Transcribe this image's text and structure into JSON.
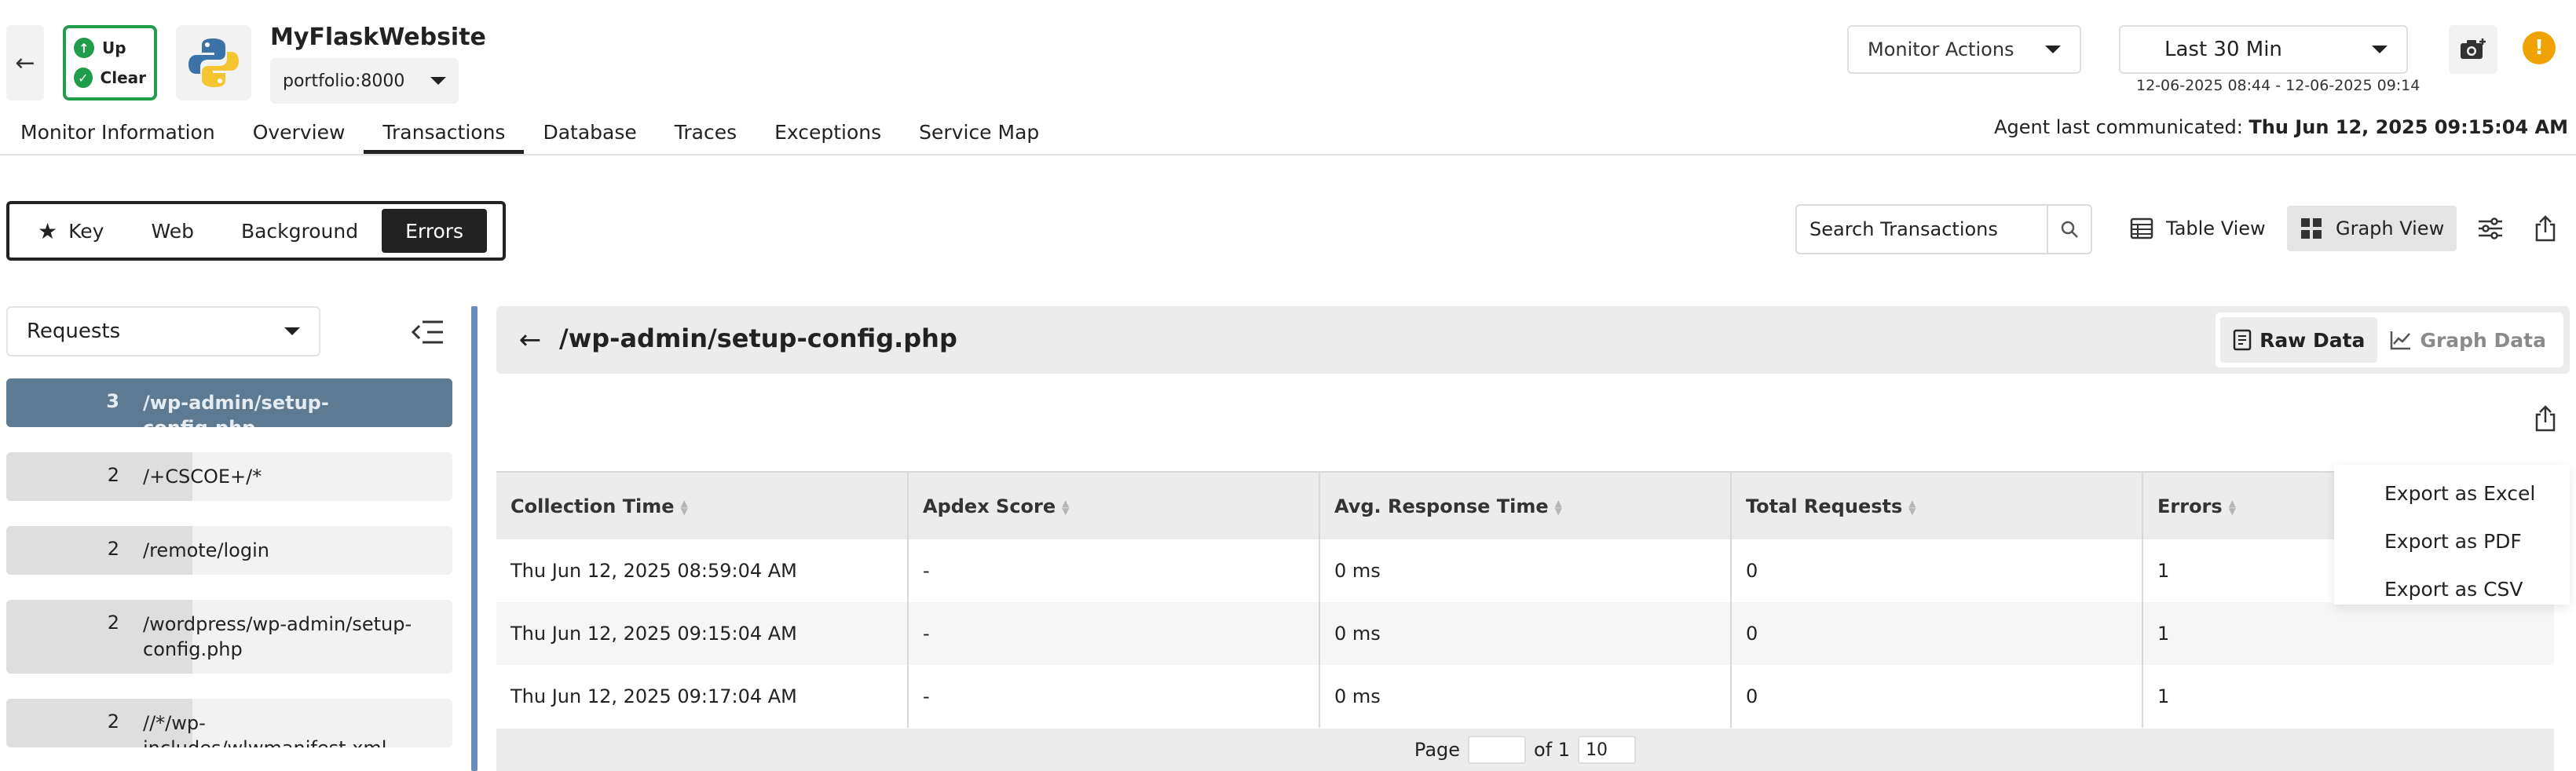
{
  "header": {
    "status_up": "Up",
    "status_clear": "Clear",
    "app_name": "MyFlaskWebsite",
    "instance": "portfolio:8000",
    "monitor_actions": "Monitor Actions",
    "time_range": "Last 30 Min",
    "time_detail": "12-06-2025 08:44 - 12-06-2025 09:14",
    "alert_glyph": "!",
    "status_color": "#1f9d4a",
    "alert_color": "#f0a202"
  },
  "nav": {
    "tabs": [
      "Monitor Information",
      "Overview",
      "Transactions",
      "Database",
      "Traces",
      "Exceptions",
      "Service Map"
    ],
    "active_tab": "Transactions",
    "agent_label": "Agent last communicated: ",
    "agent_time": "Thu Jun 12, 2025 09:15:04 AM"
  },
  "filters": {
    "types": [
      "Key",
      "Web",
      "Background",
      "Errors"
    ],
    "active_type": "Errors",
    "search_placeholder": "Search Transactions",
    "table_view_label": "Table View",
    "graph_view_label": "Graph View"
  },
  "left_panel": {
    "metric": "Requests",
    "items": [
      {
        "count": "3",
        "path": "/wp-admin/setup-config.php",
        "fraction": 1.0,
        "active": true
      },
      {
        "count": "2",
        "path": "/+CSCOE+/*",
        "fraction": 0.6667,
        "active": false
      },
      {
        "count": "2",
        "path": "/remote/login",
        "fraction": 0.6667,
        "active": false
      },
      {
        "count": "2",
        "path": "/wordpress/wp-admin/setup-config.php",
        "fraction": 0.6667,
        "active": false
      },
      {
        "count": "2",
        "path": "//*/wp-includes/wlwmanifest.xml",
        "fraction": 0.6667,
        "active": false
      }
    ]
  },
  "detail": {
    "title": "/wp-admin/setup-config.php",
    "raw_data_label": "Raw Data",
    "graph_data_label": "Graph Data",
    "columns": [
      "Collection Time",
      "Apdex Score",
      "Avg. Response Time",
      "Total Requests",
      "Errors"
    ],
    "rows": [
      [
        "Thu Jun 12, 2025 08:59:04 AM",
        "-",
        "0 ms",
        "0",
        "1"
      ],
      [
        "Thu Jun 12, 2025 09:15:04 AM",
        "-",
        "0 ms",
        "0",
        "1"
      ],
      [
        "Thu Jun 12, 2025 09:17:04 AM",
        "-",
        "0 ms",
        "0",
        "1"
      ]
    ],
    "pagination": {
      "page_label": "Page",
      "of_label": "of 1",
      "page_size": "10"
    }
  },
  "export_menu": {
    "items": [
      "Export as Excel",
      "Export as PDF",
      "Export as CSV"
    ]
  }
}
